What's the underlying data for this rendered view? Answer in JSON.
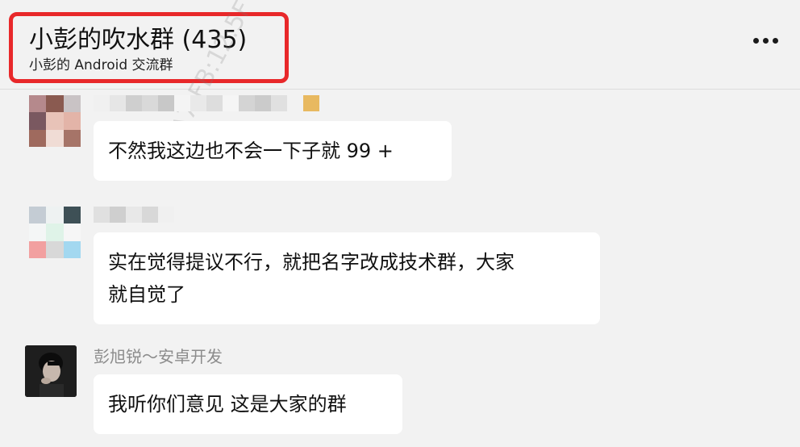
{
  "header": {
    "title": "小彭的吹水群 (435)",
    "subtitle": "小彭的 Android 交流群",
    "highlight_color": "#e8282a"
  },
  "watermark": {
    "text": "96C:A7:FB:12:5F"
  },
  "messages": [
    {
      "sender": "",
      "sender_redacted": true,
      "text": "不然我这边也不会一下子就 99 +"
    },
    {
      "sender": "",
      "sender_redacted": true,
      "text_line1": "实在觉得提议不行，就把名字改成技术群，大家",
      "text_line2": "就自觉了"
    },
    {
      "sender": "彭旭锐～安卓开发",
      "sender_redacted": false,
      "text": "我听你们意见 这是大家的群"
    }
  ],
  "colors": {
    "background": "#f2f2f2",
    "bubble": "#ffffff",
    "sender_name": "#8c8c8c"
  }
}
